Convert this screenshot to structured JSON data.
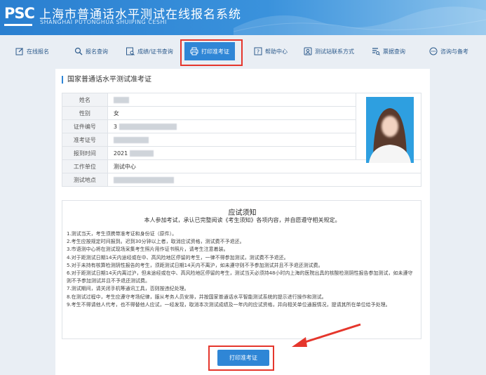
{
  "header": {
    "logo": "PSC",
    "title": "上海市普通话水平测试在线报名系统",
    "subtitle": "SHANGHAI PUTONGHUA SHUIPING CESHI"
  },
  "nav": [
    {
      "label": "在线报名",
      "icon": "edit-icon"
    },
    {
      "label": "报名查询",
      "icon": "search-icon"
    },
    {
      "label": "成绩/证书查询",
      "icon": "certificate-search-icon"
    },
    {
      "label": "打印准考证",
      "icon": "printer-icon",
      "active": true
    },
    {
      "label": "帮助中心",
      "icon": "help-icon"
    },
    {
      "label": "测试站联系方式",
      "icon": "contact-card-icon"
    },
    {
      "label": "票据查询",
      "icon": "receipt-search-icon"
    },
    {
      "label": "咨询与备考",
      "icon": "chat-icon"
    }
  ],
  "admission": {
    "section_title": "国家普通话水平测试准考证",
    "fields": [
      {
        "label": "姓名",
        "value": ""
      },
      {
        "label": "性别",
        "value": "女"
      },
      {
        "label": "证件编号",
        "value": "3"
      },
      {
        "label": "准考证号",
        "value": ""
      },
      {
        "label": "报到时间",
        "value": "2021"
      },
      {
        "label": "工作单位",
        "value": "测试中心"
      },
      {
        "label": "测试地点",
        "value": ""
      }
    ]
  },
  "notice": {
    "title": "应试须知",
    "subtitle": "本人参加考试，承认已完整阅读《考生须知》各项内容，并自愿遵守相关规定。",
    "items": [
      "1.测试当天，考生须携带准考证和身份证（原件）。",
      "2.考生应按规定时间报到。迟到30分钟以上者，取消应试资格，测试费不予退还。",
      "3.市语测中心将在测试现场采集考生照片用作证书照片，请考生注意着装。",
      "4.对于距测试日期14天内途经或在中、高风险地区停留的考生，一律不得参加测试，测试费不予退还。",
      "5.对于未持有核算检测阴性报告的考生，须距测试日期14天内不离沪，如未遵守则不予参加测试并且不予退还测试费。",
      "6.对于距测试日期14天内离过沪，但未途经或在中、高风险地区停留的考生，测试当天必须持48小时内上海的医院出具的核酸检测阴性报告参加测试，如未遵守则不予参加测试并且不予退还测试费。",
      "7.测试期间，请关闭手机等通讯工具，否则按违纪处理。",
      "8.在测试过程中，考生应遵守考场纪律，服从考务人员安排，并按国家普通话水平智能测试系统的提示进行操作和测试。",
      "9.考生不得请他人代考，也不得替他人应试，一经发现，取消本次测试成绩及一年内的应试资格，并向相关单位通报情况，提请其所在单位给予处理。"
    ]
  },
  "print_button": "打印准考证",
  "colors": {
    "accent": "#2f86d6",
    "highlight": "#e5362c"
  }
}
